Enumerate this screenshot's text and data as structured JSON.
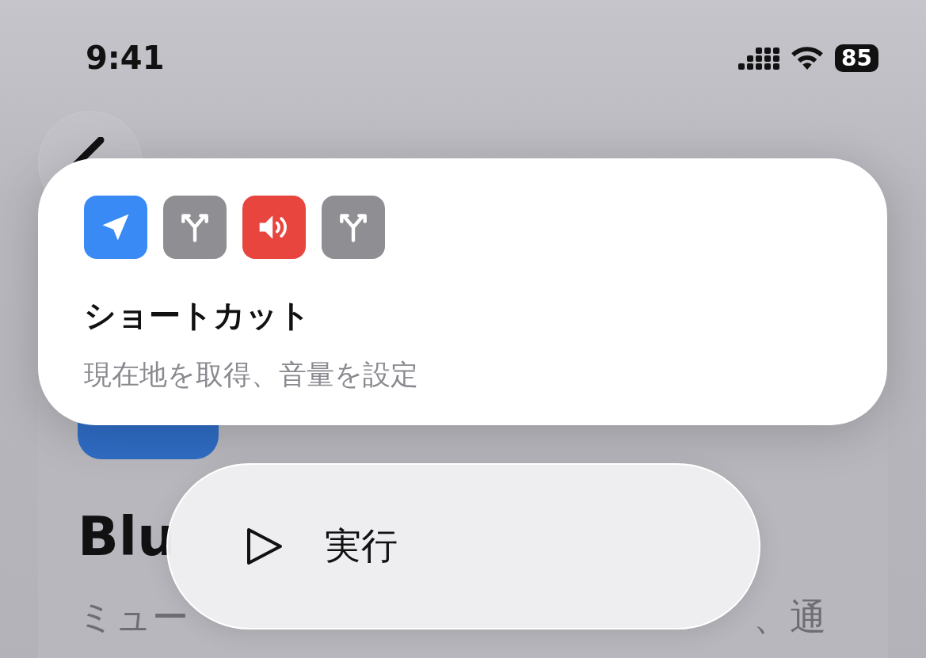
{
  "status_bar": {
    "time": "9:41",
    "battery": "85"
  },
  "background": {
    "title": "Blu",
    "description_start": "ミュー",
    "description_end": "、通"
  },
  "shortcut_card": {
    "actions": [
      {
        "kind": "location",
        "color": "#3a8af5"
      },
      {
        "kind": "branch",
        "color": "#8e8e93"
      },
      {
        "kind": "volume",
        "color": "#e8453f"
      },
      {
        "kind": "branch",
        "color": "#8e8e93"
      }
    ],
    "title": "ショートカット",
    "subtitle": "現在地を取得、音量を設定"
  },
  "menu": {
    "items": [
      {
        "kind": "run",
        "label": "実行"
      }
    ]
  }
}
